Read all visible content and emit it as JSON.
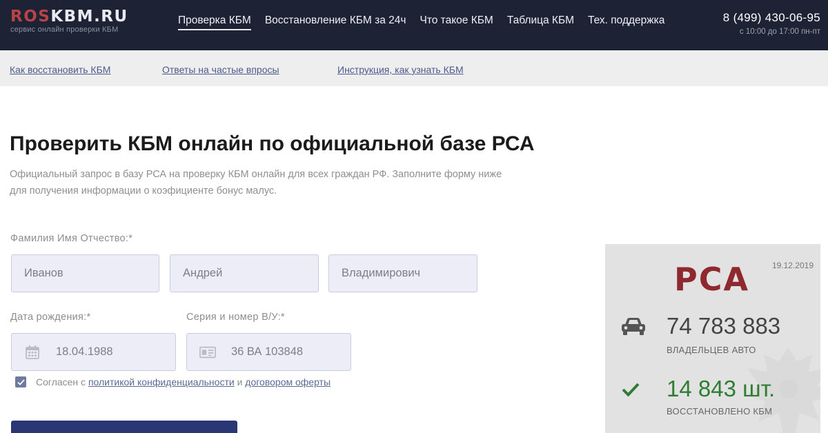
{
  "header": {
    "logo_ros": "ROS",
    "logo_rest": "KBM.RU",
    "logo_sub": "сервис онлайн проверки КБМ",
    "nav": [
      {
        "label": "Проверка КБМ",
        "active": true
      },
      {
        "label": "Восстановление КБМ за 24ч",
        "active": false
      },
      {
        "label": "Что такое КБМ",
        "active": false
      },
      {
        "label": "Таблица КБМ",
        "active": false
      },
      {
        "label": "Тех. поддержка",
        "active": false
      }
    ],
    "phone": "8 (499) 430-06-95",
    "hours": "с 10:00 до 17:00 пн-пт"
  },
  "subnav": {
    "links": [
      "Как восстановить КБМ",
      "Ответы на частые впросы",
      "Инструкция, как узнать КБМ"
    ]
  },
  "main": {
    "title_bold": "Проверить КБМ",
    "title_rest": " онлайн по официальной базе РСА",
    "description": "Официальный запрос в базу РСА на проверку КБМ онлайн для всех граждан РФ. Заполните форму ниже для получения информации о коэфициенте бонус малус."
  },
  "form": {
    "fio_label": "Фамилия Имя Отчество:*",
    "last_name": "Иванов",
    "first_name": "Андрей",
    "patronymic": "Владимирович",
    "birth_label": "Дата рождения:*",
    "birth_date": "18.04.1988",
    "license_label": "Серия и номер В/У:*",
    "license": "36 ВА 103848",
    "agree_prefix": "Согласен с ",
    "agree_policy": "политикой конфиденциальности",
    "agree_and": " и ",
    "agree_offer": "договором оферты",
    "agree_checked": true
  },
  "rsa": {
    "logo": "РСА",
    "date": "19.12.2019",
    "owners_value": "74 783 883",
    "owners_label": "ВЛАДЕЛЬЦЕВ АВТО",
    "restored_value": "14 843 шт.",
    "restored_label": "ВОССТАНОВЛЕНО КБМ"
  },
  "colors": {
    "header_bg": "#1d2335",
    "logo_accent": "#b54447",
    "field_bg": "#ecedf7",
    "button_bg": "#2b3775",
    "rsa_red": "#8e2a2f",
    "stat_green": "#2e7d32",
    "stat_dark": "#444444"
  }
}
